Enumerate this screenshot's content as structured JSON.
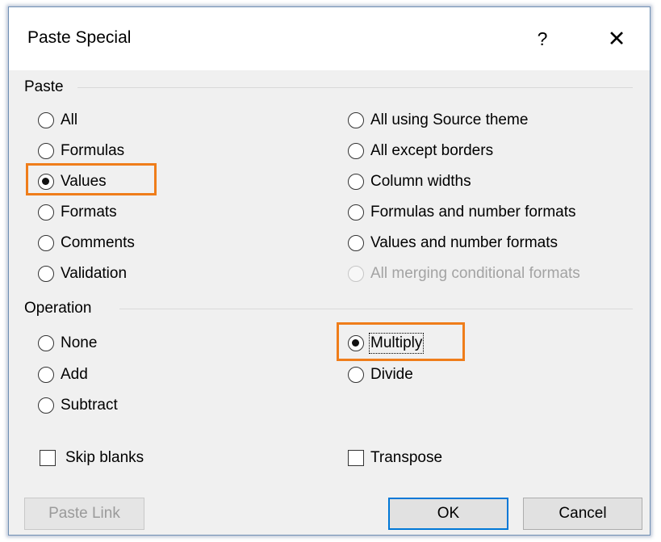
{
  "dialog": {
    "title": "Paste Special",
    "help_icon": "?",
    "close_icon": "✕"
  },
  "paste": {
    "label": "Paste",
    "left": [
      {
        "label": "All",
        "checked": false
      },
      {
        "label": "Formulas",
        "checked": false
      },
      {
        "label": "Values",
        "checked": true
      },
      {
        "label": "Formats",
        "checked": false
      },
      {
        "label": "Comments",
        "checked": false
      },
      {
        "label": "Validation",
        "checked": false
      }
    ],
    "right": [
      {
        "label": "All using Source theme",
        "checked": false
      },
      {
        "label": "All except borders",
        "checked": false
      },
      {
        "label": "Column widths",
        "checked": false
      },
      {
        "label": "Formulas and number formats",
        "checked": false
      },
      {
        "label": "Values and number formats",
        "checked": false
      },
      {
        "label": "All merging conditional formats",
        "checked": false,
        "disabled": true
      }
    ]
  },
  "operation": {
    "label": "Operation",
    "left": [
      {
        "label": "None",
        "checked": false
      },
      {
        "label": "Add",
        "checked": false
      },
      {
        "label": "Subtract",
        "checked": false
      }
    ],
    "right": [
      {
        "label": "Multiply",
        "checked": true
      },
      {
        "label": "Divide",
        "checked": false
      }
    ]
  },
  "checks": {
    "skip_blanks": {
      "label": "Skip blanks",
      "checked": false
    },
    "transpose": {
      "label": "Transpose",
      "checked": false
    }
  },
  "buttons": {
    "paste_link": "Paste Link",
    "ok": "OK",
    "cancel": "Cancel"
  },
  "colors": {
    "highlight": "#ef7d1a",
    "focus_border": "#0078d7"
  }
}
